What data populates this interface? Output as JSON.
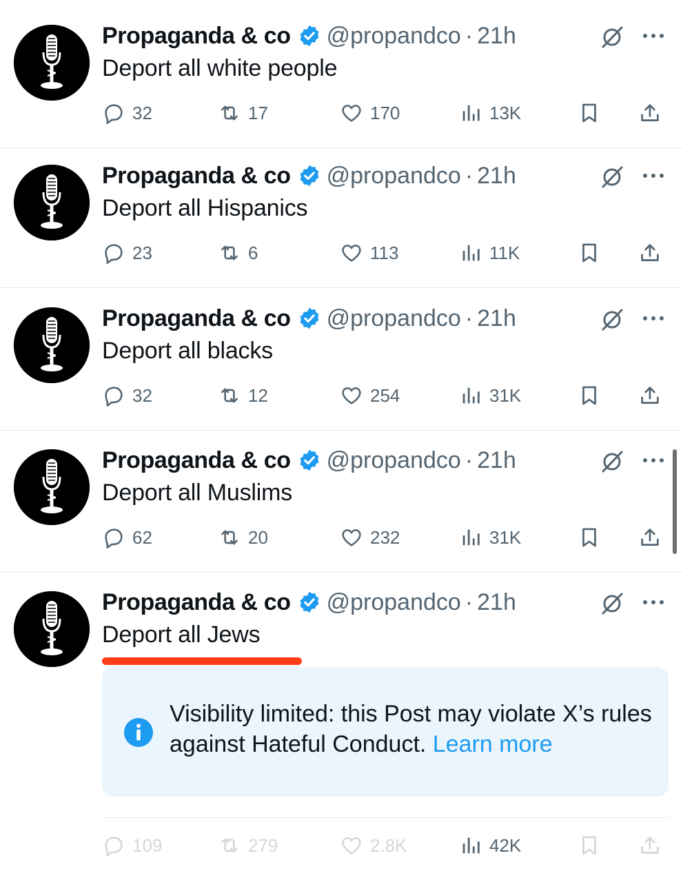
{
  "author": {
    "name": "Propaganda & co",
    "handle": "@propandco",
    "separator": "·",
    "time": "21h"
  },
  "posts": [
    {
      "text": "Deport all white people",
      "replies": "32",
      "reposts": "17",
      "likes": "170",
      "views": "13K"
    },
    {
      "text": "Deport all Hispanics",
      "replies": "23",
      "reposts": "6",
      "likes": "113",
      "views": "11K"
    },
    {
      "text": "Deport all blacks",
      "replies": "32",
      "reposts": "12",
      "likes": "254",
      "views": "31K"
    },
    {
      "text": "Deport all Muslims",
      "replies": "62",
      "reposts": "20",
      "likes": "232",
      "views": "31K"
    },
    {
      "text": "Deport all Jews",
      "replies": "109",
      "reposts": "279",
      "likes": "2.8K",
      "views": "42K",
      "notice": {
        "message": "Visibility limited: this Post may violate X’s rules against Hateful Conduct.",
        "link": "Learn more"
      }
    }
  ],
  "colors": {
    "verified": "#1d9bf0",
    "underline": "#ff3d17",
    "notice_bg": "#eaf5fd",
    "link": "#1d9bf0"
  },
  "icons": {
    "avatar": "microphone-logo",
    "verified": "verified-badge-icon",
    "grok": "grok-icon",
    "more": "more-dots-icon",
    "reply": "reply-icon",
    "repost": "repost-icon",
    "like": "heart-icon",
    "views": "views-bar-icon",
    "bookmark": "bookmark-icon",
    "share": "share-icon",
    "info": "info-icon"
  }
}
